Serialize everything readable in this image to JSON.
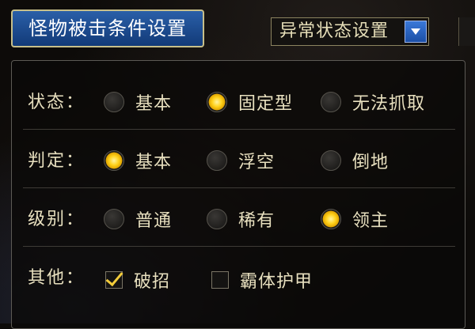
{
  "tab_button": {
    "label": "怪物被击条件设置"
  },
  "abnormal_select": {
    "value": "异常状态设置"
  },
  "settings": {
    "state": {
      "label": "状态：",
      "options": [
        {
          "label": "基本",
          "selected": false
        },
        {
          "label": "固定型",
          "selected": true
        },
        {
          "label": "无法抓取",
          "selected": false
        }
      ]
    },
    "judge": {
      "label": "判定：",
      "options": [
        {
          "label": "基本",
          "selected": true
        },
        {
          "label": "浮空",
          "selected": false
        },
        {
          "label": "倒地",
          "selected": false
        }
      ]
    },
    "level": {
      "label": "级别：",
      "options": [
        {
          "label": "普通",
          "selected": false
        },
        {
          "label": "稀有",
          "selected": false
        },
        {
          "label": "领主",
          "selected": true
        }
      ]
    },
    "other": {
      "label": "其他：",
      "options": [
        {
          "label": "破招",
          "checked": true
        },
        {
          "label": "霸体护甲",
          "checked": false
        }
      ]
    }
  },
  "colors": {
    "accent": "#ffd21c",
    "tab_blue": "#1f4f96",
    "text": "#e8e0bf"
  }
}
